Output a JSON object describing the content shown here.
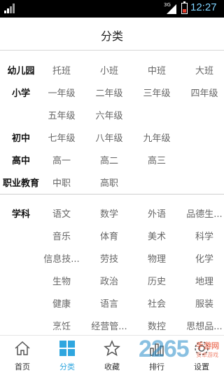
{
  "status_bar": {
    "network": "3G",
    "time": "12:27",
    "time_color": "#7fd3ff",
    "battery_level": 0.35
  },
  "header": {
    "title": "分类"
  },
  "sections": [
    {
      "rows": [
        {
          "label": "幼儿园",
          "items": [
            "托班",
            "小班",
            "中班",
            "大班"
          ]
        },
        {
          "label": "小学",
          "items": [
            "一年级",
            "二年级",
            "三年级",
            "四年级"
          ]
        },
        {
          "label": "",
          "items": [
            "五年级",
            "六年级"
          ]
        },
        {
          "label": "初中",
          "items": [
            "七年级",
            "八年级",
            "九年级"
          ]
        },
        {
          "label": "高中",
          "items": [
            "高一",
            "高二",
            "高三"
          ]
        },
        {
          "label": "职业教育",
          "items": [
            "中职",
            "高职"
          ]
        }
      ]
    },
    {
      "rows": [
        {
          "label": "学科",
          "items": [
            "语文",
            "数学",
            "外语",
            "品德生..."
          ]
        },
        {
          "label": "",
          "items": [
            "音乐",
            "体育",
            "美术",
            "科学"
          ]
        },
        {
          "label": "",
          "items": [
            "信息技...",
            "劳技",
            "物理",
            "化学"
          ]
        },
        {
          "label": "",
          "items": [
            "生物",
            "政治",
            "历史",
            "地理"
          ]
        },
        {
          "label": "",
          "items": [
            "健康",
            "语言",
            "社会",
            "服装"
          ]
        },
        {
          "label": "",
          "items": [
            "烹饪",
            "经营管...",
            "数控",
            "思想品..."
          ]
        }
      ]
    }
  ],
  "tabs": [
    {
      "label": "首页",
      "icon": "home-icon",
      "active": false
    },
    {
      "label": "分类",
      "icon": "grid-icon",
      "active": true
    },
    {
      "label": "收藏",
      "icon": "star-icon",
      "active": false
    },
    {
      "label": "排行",
      "icon": "ranking-icon",
      "active": false
    },
    {
      "label": "设置",
      "icon": "gear-icon",
      "active": false
    }
  ],
  "watermark": {
    "brand": "2265",
    "suffix": ".com",
    "sub_top": "手游网",
    "sub_bottom": "安卓游戏"
  },
  "colors": {
    "accent": "#2fa6df",
    "label": "#111111",
    "item": "#666666"
  }
}
